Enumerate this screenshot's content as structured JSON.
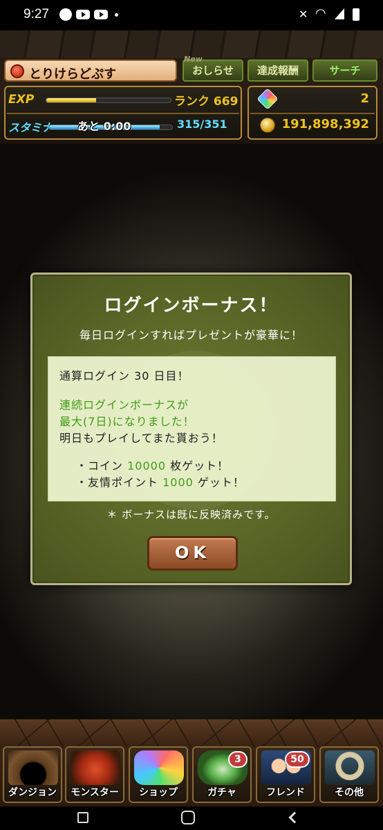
{
  "status_bar": {
    "time": "9:27"
  },
  "header": {
    "player_name": "とりけらどぷす",
    "news_new_tag": "New",
    "news_label": "おしらせ",
    "achievements_label": "達成報酬",
    "search_label": "サーチ",
    "exp_label": "EXP",
    "exp_progress": 0.4,
    "rank_text": "ランク 669",
    "stamina_label": "スタミナ",
    "stamina_timer": "あと 0:00",
    "stamina_value": "315/351",
    "stamina_progress": 0.9,
    "magic_stones": "2",
    "coins": "191,898,392"
  },
  "dialog": {
    "title": "ログインボーナス！",
    "subtitle": "毎日ログインすればプレゼントが豪華に！",
    "total_login": "通算ログイン 30 日目！",
    "streak_line1": "連続ログインボーナスが",
    "streak_line2": "最大(7日)になりました！",
    "tomorrow": "明日もプレイしてまた貰おう！",
    "reward1_prefix": "・コイン ",
    "reward1_value": "10000",
    "reward1_suffix": " 枚ゲット！",
    "reward2_prefix": "・友情ポイント ",
    "reward2_value": "1000",
    "reward2_suffix": " ゲット！",
    "note": "＊ ボーナスは既に反映済みです。",
    "ok_label": "OK"
  },
  "bottom_nav": {
    "items": [
      {
        "label": "ダンジョン",
        "icon": "dungeon-gate-icon"
      },
      {
        "label": "モンスター",
        "icon": "dragon-icon"
      },
      {
        "label": "ショップ",
        "icon": "rainbow-gem-icon"
      },
      {
        "label": "ガチャ",
        "icon": "egg-icon",
        "badge": "3"
      },
      {
        "label": "フレンド",
        "icon": "friends-icon",
        "badge": "50"
      },
      {
        "label": "その他",
        "icon": "question-mark-icon"
      }
    ]
  },
  "colors": {
    "dialog_green": "#586526",
    "highlight_green": "#3f9c14",
    "gold_text": "#f1c21d",
    "stamina_blue": "#5de0ff"
  }
}
